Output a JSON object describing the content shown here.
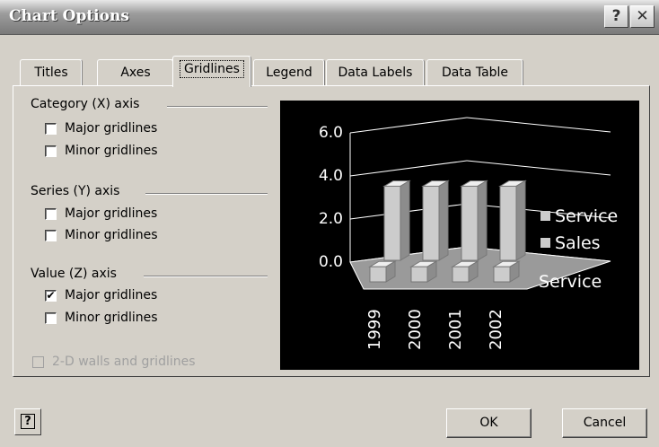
{
  "window": {
    "title": "Chart Options",
    "help_glyph": "?",
    "close_glyph": "✕"
  },
  "tabs": [
    {
      "label": "Titles"
    },
    {
      "label": "Axes"
    },
    {
      "label": "Gridlines",
      "active": true
    },
    {
      "label": "Legend"
    },
    {
      "label": "Data Labels"
    },
    {
      "label": "Data Table"
    }
  ],
  "groups": {
    "category": {
      "title": "Category (X) axis",
      "major": {
        "label": "Major gridlines",
        "checked": false
      },
      "minor": {
        "label": "Minor gridlines",
        "checked": false
      }
    },
    "series": {
      "title": "Series (Y) axis",
      "major": {
        "label": "Major gridlines",
        "checked": false
      },
      "minor": {
        "label": "Minor gridlines",
        "checked": false
      }
    },
    "value": {
      "title": "Value (Z) axis",
      "major": {
        "label": "Major gridlines",
        "checked": true
      },
      "minor": {
        "label": "Minor gridlines",
        "checked": false
      }
    }
  },
  "walls_option": {
    "label": "2-D walls and gridlines",
    "checked": false,
    "enabled": false
  },
  "buttons": {
    "ok": "OK",
    "cancel": "Cancel",
    "help_icon": "?"
  },
  "chart_data": {
    "type": "bar",
    "categories": [
      "1999",
      "2000",
      "2001",
      "2002"
    ],
    "series": [
      {
        "name": "Sales",
        "values": [
          0.5,
          0.5,
          0.5,
          0.5
        ]
      },
      {
        "name": "Service",
        "values": [
          4.0,
          4.0,
          4.0,
          4.0
        ]
      }
    ],
    "depth_axis_label": "Service",
    "legend_entries": [
      "Service",
      "Sales"
    ],
    "yticks": [
      "0.0",
      "2.0",
      "4.0",
      "6.0"
    ],
    "ylim": [
      0,
      6
    ],
    "grid": "value major gridlines",
    "legend_position": "right",
    "colors": {
      "background": "#000000",
      "bars": "#cccccc",
      "text": "#ffffff"
    }
  }
}
